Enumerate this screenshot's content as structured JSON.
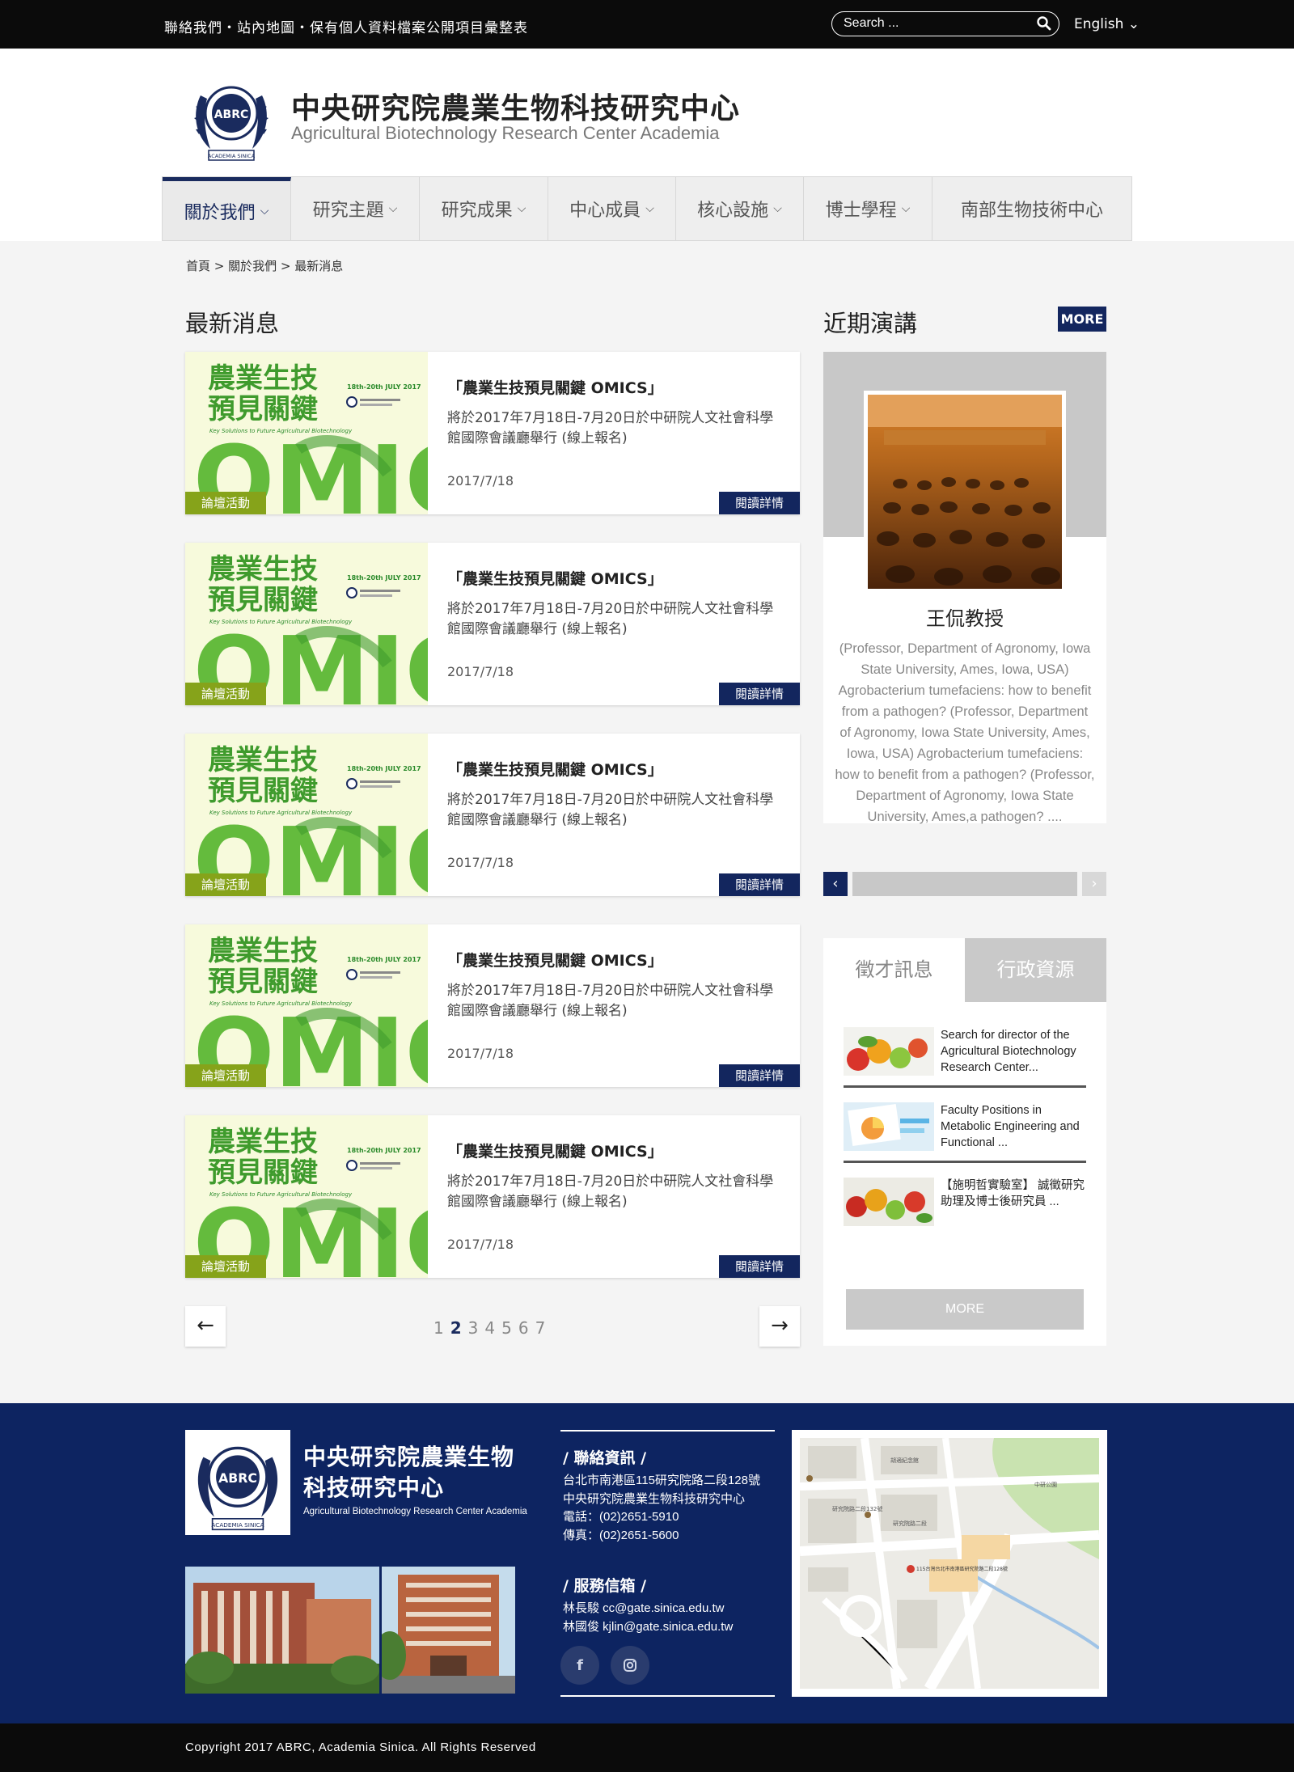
{
  "topbar": {
    "links": "聯絡我們・站內地圖・保有個人資料檔案公開項目彙整表",
    "search_placeholder": "Search ...",
    "language": "English"
  },
  "header": {
    "title_zh": "中央研究院農業生物科技研究中心",
    "title_en": "Agricultural Biotechnology Research Center Academia",
    "logo_text": "ABRC",
    "logo_sub": "ACADEMIA SINICA"
  },
  "nav": {
    "items": [
      {
        "label": "關於我們",
        "active": true
      },
      {
        "label": "研究主題"
      },
      {
        "label": "研究成果"
      },
      {
        "label": "中心成員"
      },
      {
        "label": "核心設施"
      },
      {
        "label": "博士學程"
      },
      {
        "label": "南部生物技術中心"
      }
    ]
  },
  "breadcrumb": "首頁 > 關於我們 > 最新消息",
  "news": {
    "title": "最新消息",
    "items": [
      {
        "tag": "論壇活動",
        "title": "「農業生技預見關鍵 OMICS」",
        "desc": "將於2017年7月18日-7月20日於中研院人文社會科學館國際會議廳舉行 (線上報名)",
        "date": "2017/7/18",
        "more": "閱讀詳情"
      },
      {
        "tag": "論壇活動",
        "title": "「農業生技預見關鍵 OMICS」",
        "desc": "將於2017年7月18日-7月20日於中研院人文社會科學館國際會議廳舉行 (線上報名)",
        "date": "2017/7/18",
        "more": "閱讀詳情"
      },
      {
        "tag": "論壇活動",
        "title": "「農業生技預見關鍵 OMICS」",
        "desc": "將於2017年7月18日-7月20日於中研院人文社會科學館國際會議廳舉行 (線上報名)",
        "date": "2017/7/18",
        "more": "閱讀詳情"
      },
      {
        "tag": "論壇活動",
        "title": "「農業生技預見關鍵 OMICS」",
        "desc": "將於2017年7月18日-7月20日於中研院人文社會科學館國際會議廳舉行 (線上報名)",
        "date": "2017/7/18",
        "more": "閱讀詳情"
      },
      {
        "tag": "論壇活動",
        "title": "「農業生技預見關鍵 OMICS」",
        "desc": "將於2017年7月18日-7月20日於中研院人文社會科學館國際會議廳舉行 (線上報名)",
        "date": "2017/7/18",
        "more": "閱讀詳情"
      }
    ],
    "poster": {
      "line1": "農業生技",
      "line2": "預見關鍵",
      "date_text": "18th-20th JULY 2017",
      "tagline": "Key Solutions to Future Agricultural Biotechnology",
      "big": "OMICS"
    }
  },
  "pagination": {
    "prev": "←",
    "next": "→",
    "pages": [
      "1",
      "2",
      "3",
      "4",
      "5",
      "6",
      "7"
    ],
    "current": "2"
  },
  "lectures": {
    "title": "近期演講",
    "more": "MORE",
    "speaker": "王侃教授",
    "description": "(Professor, Department of Agronomy, Iowa State University, Ames, Iowa, USA) Agrobacterium tumefaciens: how to benefit from a pathogen?  (Professor, Department of Agronomy, Iowa State University, Ames, Iowa, USA) Agrobacterium tumefaciens: how to benefit from a pathogen?  (Professor, Department of Agronomy, Iowa State University, Ames,a pathogen? ....",
    "prev": "‹",
    "next": "›"
  },
  "tabs": {
    "tab1": "徵才訊息",
    "tab2": "行政資源",
    "jobs": [
      {
        "text": "Search for director of the Agricultural Biotechnology Research Center..."
      },
      {
        "text": "Faculty Positions in Metabolic Engineering and Functional  ..."
      },
      {
        "text": "【施明哲實驗室】 誠徵研究助理及博士後研究員 ..."
      }
    ],
    "more": "MORE"
  },
  "footer": {
    "title": "中央研究院農業生物科技研究中心",
    "subtitle": "Agricultural Biotechnology Research Center Academia",
    "contact_heading": "/  聯絡資訊  /",
    "address1": "台北市南港區115研究院路二段128號",
    "address2": "中央研究院農業生物科技研究中心",
    "phone": "電話：(02)2651-5910",
    "fax": "傳真：(02)2651-5600",
    "mail_heading": "/  服務信箱  /",
    "mail1": "林長駿  cc@gate.sinica.edu.tw",
    "mail2": "林國俊  kjlin@gate.sinica.edu.tw",
    "map_labels": [
      "胡適紀念館",
      "研究院路二段132號",
      "研究院路二段",
      "115台灣台北市南港區研究院路二段128號",
      "中研公園"
    ]
  },
  "copyright": "Copyright 2017 ABRC, Academia Sinica. All Rights Reserved"
}
